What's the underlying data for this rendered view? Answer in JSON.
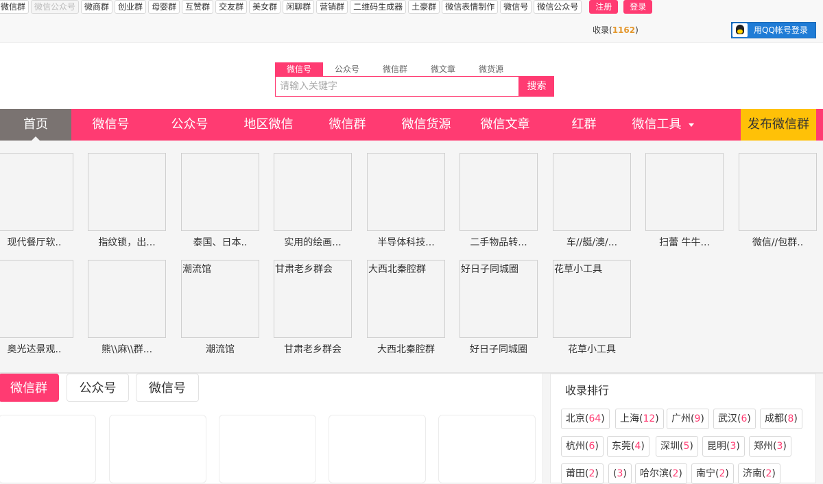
{
  "topbar": {
    "tags": [
      {
        "label": "微信群",
        "faded": false
      },
      {
        "label": "微信公众号",
        "faded": true
      },
      {
        "label": "微商群",
        "faded": false
      },
      {
        "label": "创业群",
        "faded": false
      },
      {
        "label": "母婴群",
        "faded": false
      },
      {
        "label": "互赞群",
        "faded": false
      },
      {
        "label": "交友群",
        "faded": false
      },
      {
        "label": "美女群",
        "faded": false
      },
      {
        "label": "闲聊群",
        "faded": false
      },
      {
        "label": "营销群",
        "faded": false
      },
      {
        "label": "二维码生成器",
        "faded": false
      },
      {
        "label": "土豪群",
        "faded": false
      },
      {
        "label": "微信表情制作",
        "faded": false
      },
      {
        "label": "微信号",
        "faded": false
      },
      {
        "label": "微信公众号",
        "faded": false
      }
    ],
    "register_label": "注册",
    "login_label": "登录",
    "collect_label": "收录",
    "collect_open": "(",
    "collect_count": "1162",
    "collect_close": ")",
    "qq_login_label": "用QQ帐号登录"
  },
  "search": {
    "tabs": [
      "微信号",
      "公众号",
      "微信群",
      "微文章",
      "微货源"
    ],
    "active_tab": 0,
    "placeholder": "请输入关键字",
    "button_label": "搜索"
  },
  "nav": {
    "home": "首页",
    "items": [
      "微信号",
      "公众号",
      "地区微信",
      "微信群",
      "微信货源",
      "微信文章",
      "红群"
    ],
    "tools": "微信工具",
    "publish": "发布微信群"
  },
  "grid": {
    "row1": [
      {
        "thumb": "",
        "caption": "现代餐厅软.."
      },
      {
        "thumb": "",
        "caption": "指纹锁，出..."
      },
      {
        "thumb": "",
        "caption": "泰国、日本.."
      },
      {
        "thumb": "",
        "caption": "实用的绘画..."
      },
      {
        "thumb": "",
        "caption": "半导体科技..."
      },
      {
        "thumb": "",
        "caption": "二手物品转..."
      },
      {
        "thumb": "",
        "caption": "车//艇/澳/..."
      },
      {
        "thumb": "",
        "caption": "扫蕾 牛牛..."
      },
      {
        "thumb": "",
        "caption": "微信//包群.."
      }
    ],
    "row2": [
      {
        "thumb": "",
        "caption": "奥光达景观.."
      },
      {
        "thumb": "",
        "caption": "熊\\\\麻\\\\群..."
      },
      {
        "thumb": "潮流馆",
        "caption": "潮流馆"
      },
      {
        "thumb": "甘肃老乡群会",
        "caption": "甘肃老乡群会"
      },
      {
        "thumb": "大西北秦腔群",
        "caption": "大西北秦腔群"
      },
      {
        "thumb": "好日子同城圈",
        "caption": "好日子同城圈"
      },
      {
        "thumb": "花草小工具",
        "caption": "花草小工具"
      }
    ]
  },
  "listing": {
    "tabs": [
      "微信群",
      "公众号",
      "微信号"
    ],
    "active_tab": 0
  },
  "ranking": {
    "title": "收录排行",
    "cities": [
      {
        "name": "北京",
        "count": "64"
      },
      {
        "name": "上海",
        "count": "12"
      },
      {
        "name": "广州",
        "count": "9"
      },
      {
        "name": "武汉",
        "count": "6"
      },
      {
        "name": "成都",
        "count": "8"
      },
      {
        "name": "杭州",
        "count": "6"
      },
      {
        "name": "东莞",
        "count": "4"
      },
      {
        "name": "深圳",
        "count": "5"
      },
      {
        "name": "昆明",
        "count": "3"
      },
      {
        "name": "郑州",
        "count": "3"
      },
      {
        "name": "莆田",
        "count": "2"
      },
      {
        "name": "",
        "count": "3"
      },
      {
        "name": "哈尔滨",
        "count": "2"
      },
      {
        "name": "南宁",
        "count": "2"
      },
      {
        "name": "济南",
        "count": "2"
      }
    ]
  },
  "colors": {
    "accent": "#ff3b72",
    "home_bg": "#7a7371",
    "publish_bg": "#ffc107",
    "count_orange": "#e4972d",
    "qq_blue": "#1f7cd6"
  }
}
